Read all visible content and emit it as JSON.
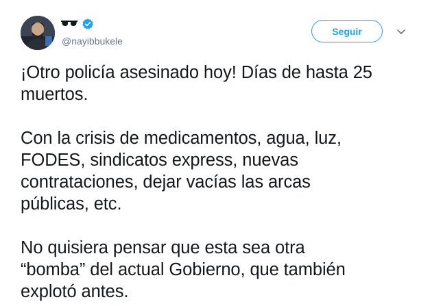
{
  "tweet": {
    "handle": "@nayibbukele",
    "display_name_icon": "sunglasses-icon",
    "verified_icon": "verified-badge-icon",
    "follow_button_label": "Seguir",
    "menu_icon": "chevron-down-icon",
    "paragraphs": [
      {
        "lines": [
          "¡Otro policía asesinado hoy! Días de hasta 25",
          "muertos."
        ]
      },
      {
        "lines": [
          "Con la crisis de medicamentos, agua, luz,",
          "FODES, sindicatos express, nuevas",
          "contrataciones, dejar vacías las arcas",
          "públicas, etc."
        ]
      },
      {
        "lines": [
          "No quisiera pensar que esta sea otra",
          "“bomba” del actual Gobierno, que también",
          "explotó antes."
        ]
      }
    ]
  },
  "colors": {
    "accent": "#1da1f2",
    "text": "#14171a",
    "secondary_text": "#657786"
  }
}
